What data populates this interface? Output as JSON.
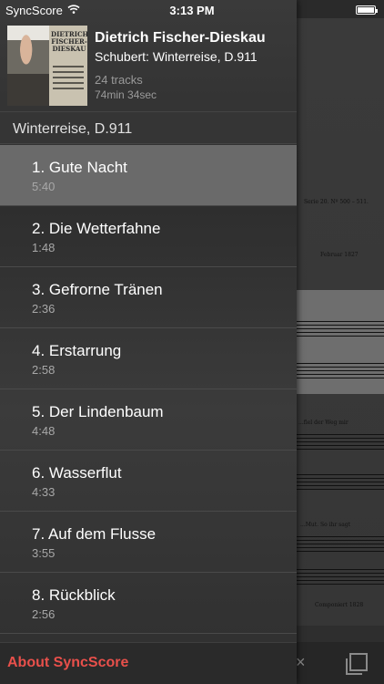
{
  "status_bar": {
    "carrier": "SyncScore",
    "time": "3:13 PM"
  },
  "album": {
    "cover_lettering": "DIETRICH FISCHER-DIESKAU",
    "artist": "Dietrich Fischer-Dieskau",
    "title": "Schubert: Winterreise, D.911",
    "track_count": "24 tracks",
    "duration": "74min 34sec"
  },
  "section": {
    "title": "Winterreise, D.911"
  },
  "tracks": [
    {
      "name": "1. Gute Nacht",
      "time": "5:40",
      "selected": true
    },
    {
      "name": "2. Die Wetterfahne",
      "time": "1:48",
      "selected": false
    },
    {
      "name": "3. Gefrorne Tränen",
      "time": "2:36",
      "selected": false
    },
    {
      "name": "4. Erstarrung",
      "time": "2:58",
      "selected": false
    },
    {
      "name": "5. Der Lindenbaum",
      "time": "4:48",
      "selected": false
    },
    {
      "name": "6. Wasserflut",
      "time": "4:33",
      "selected": false
    },
    {
      "name": "7. Auf dem Flusse",
      "time": "3:55",
      "selected": false
    },
    {
      "name": "8. Rückblick",
      "time": "2:56",
      "selected": false
    }
  ],
  "footer": {
    "about_label": "About SyncScore",
    "about_color": "#e8504b"
  },
  "score": {
    "header_text": "Serie 20. Nº 500 – 511.",
    "date_text": "Februar 1827",
    "lyric_1": "...fiel der Weg mir",
    "lyric_2": "...Mut. So ihr sagt",
    "footer_text": "Componiert 1828"
  },
  "toolbar": {
    "close_glyph": "×"
  },
  "icons": [
    "wifi-icon",
    "battery-icon",
    "close-icon",
    "pages-icon"
  ]
}
